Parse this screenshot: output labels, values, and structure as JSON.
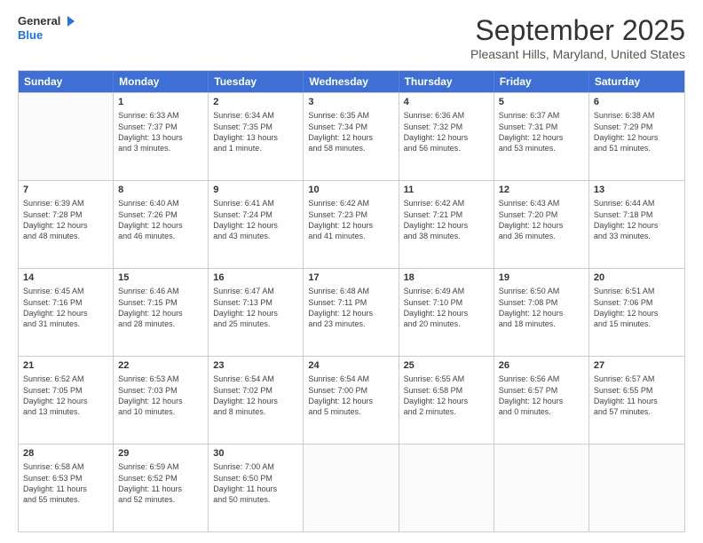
{
  "header": {
    "logo_line1": "General",
    "logo_line2": "Blue",
    "month": "September 2025",
    "location": "Pleasant Hills, Maryland, United States"
  },
  "days": [
    "Sunday",
    "Monday",
    "Tuesday",
    "Wednesday",
    "Thursday",
    "Friday",
    "Saturday"
  ],
  "rows": [
    [
      {
        "day": "",
        "sunrise": "",
        "sunset": "",
        "daylight": ""
      },
      {
        "day": "1",
        "sunrise": "Sunrise: 6:33 AM",
        "sunset": "Sunset: 7:37 PM",
        "daylight": "Daylight: 13 hours",
        "daylight2": "and 3 minutes."
      },
      {
        "day": "2",
        "sunrise": "Sunrise: 6:34 AM",
        "sunset": "Sunset: 7:35 PM",
        "daylight": "Daylight: 13 hours",
        "daylight2": "and 1 minute."
      },
      {
        "day": "3",
        "sunrise": "Sunrise: 6:35 AM",
        "sunset": "Sunset: 7:34 PM",
        "daylight": "Daylight: 12 hours",
        "daylight2": "and 58 minutes."
      },
      {
        "day": "4",
        "sunrise": "Sunrise: 6:36 AM",
        "sunset": "Sunset: 7:32 PM",
        "daylight": "Daylight: 12 hours",
        "daylight2": "and 56 minutes."
      },
      {
        "day": "5",
        "sunrise": "Sunrise: 6:37 AM",
        "sunset": "Sunset: 7:31 PM",
        "daylight": "Daylight: 12 hours",
        "daylight2": "and 53 minutes."
      },
      {
        "day": "6",
        "sunrise": "Sunrise: 6:38 AM",
        "sunset": "Sunset: 7:29 PM",
        "daylight": "Daylight: 12 hours",
        "daylight2": "and 51 minutes."
      }
    ],
    [
      {
        "day": "7",
        "sunrise": "Sunrise: 6:39 AM",
        "sunset": "Sunset: 7:28 PM",
        "daylight": "Daylight: 12 hours",
        "daylight2": "and 48 minutes."
      },
      {
        "day": "8",
        "sunrise": "Sunrise: 6:40 AM",
        "sunset": "Sunset: 7:26 PM",
        "daylight": "Daylight: 12 hours",
        "daylight2": "and 46 minutes."
      },
      {
        "day": "9",
        "sunrise": "Sunrise: 6:41 AM",
        "sunset": "Sunset: 7:24 PM",
        "daylight": "Daylight: 12 hours",
        "daylight2": "and 43 minutes."
      },
      {
        "day": "10",
        "sunrise": "Sunrise: 6:42 AM",
        "sunset": "Sunset: 7:23 PM",
        "daylight": "Daylight: 12 hours",
        "daylight2": "and 41 minutes."
      },
      {
        "day": "11",
        "sunrise": "Sunrise: 6:42 AM",
        "sunset": "Sunset: 7:21 PM",
        "daylight": "Daylight: 12 hours",
        "daylight2": "and 38 minutes."
      },
      {
        "day": "12",
        "sunrise": "Sunrise: 6:43 AM",
        "sunset": "Sunset: 7:20 PM",
        "daylight": "Daylight: 12 hours",
        "daylight2": "and 36 minutes."
      },
      {
        "day": "13",
        "sunrise": "Sunrise: 6:44 AM",
        "sunset": "Sunset: 7:18 PM",
        "daylight": "Daylight: 12 hours",
        "daylight2": "and 33 minutes."
      }
    ],
    [
      {
        "day": "14",
        "sunrise": "Sunrise: 6:45 AM",
        "sunset": "Sunset: 7:16 PM",
        "daylight": "Daylight: 12 hours",
        "daylight2": "and 31 minutes."
      },
      {
        "day": "15",
        "sunrise": "Sunrise: 6:46 AM",
        "sunset": "Sunset: 7:15 PM",
        "daylight": "Daylight: 12 hours",
        "daylight2": "and 28 minutes."
      },
      {
        "day": "16",
        "sunrise": "Sunrise: 6:47 AM",
        "sunset": "Sunset: 7:13 PM",
        "daylight": "Daylight: 12 hours",
        "daylight2": "and 25 minutes."
      },
      {
        "day": "17",
        "sunrise": "Sunrise: 6:48 AM",
        "sunset": "Sunset: 7:11 PM",
        "daylight": "Daylight: 12 hours",
        "daylight2": "and 23 minutes."
      },
      {
        "day": "18",
        "sunrise": "Sunrise: 6:49 AM",
        "sunset": "Sunset: 7:10 PM",
        "daylight": "Daylight: 12 hours",
        "daylight2": "and 20 minutes."
      },
      {
        "day": "19",
        "sunrise": "Sunrise: 6:50 AM",
        "sunset": "Sunset: 7:08 PM",
        "daylight": "Daylight: 12 hours",
        "daylight2": "and 18 minutes."
      },
      {
        "day": "20",
        "sunrise": "Sunrise: 6:51 AM",
        "sunset": "Sunset: 7:06 PM",
        "daylight": "Daylight: 12 hours",
        "daylight2": "and 15 minutes."
      }
    ],
    [
      {
        "day": "21",
        "sunrise": "Sunrise: 6:52 AM",
        "sunset": "Sunset: 7:05 PM",
        "daylight": "Daylight: 12 hours",
        "daylight2": "and 13 minutes."
      },
      {
        "day": "22",
        "sunrise": "Sunrise: 6:53 AM",
        "sunset": "Sunset: 7:03 PM",
        "daylight": "Daylight: 12 hours",
        "daylight2": "and 10 minutes."
      },
      {
        "day": "23",
        "sunrise": "Sunrise: 6:54 AM",
        "sunset": "Sunset: 7:02 PM",
        "daylight": "Daylight: 12 hours",
        "daylight2": "and 8 minutes."
      },
      {
        "day": "24",
        "sunrise": "Sunrise: 6:54 AM",
        "sunset": "Sunset: 7:00 PM",
        "daylight": "Daylight: 12 hours",
        "daylight2": "and 5 minutes."
      },
      {
        "day": "25",
        "sunrise": "Sunrise: 6:55 AM",
        "sunset": "Sunset: 6:58 PM",
        "daylight": "Daylight: 12 hours",
        "daylight2": "and 2 minutes."
      },
      {
        "day": "26",
        "sunrise": "Sunrise: 6:56 AM",
        "sunset": "Sunset: 6:57 PM",
        "daylight": "Daylight: 12 hours",
        "daylight2": "and 0 minutes."
      },
      {
        "day": "27",
        "sunrise": "Sunrise: 6:57 AM",
        "sunset": "Sunset: 6:55 PM",
        "daylight": "Daylight: 11 hours",
        "daylight2": "and 57 minutes."
      }
    ],
    [
      {
        "day": "28",
        "sunrise": "Sunrise: 6:58 AM",
        "sunset": "Sunset: 6:53 PM",
        "daylight": "Daylight: 11 hours",
        "daylight2": "and 55 minutes."
      },
      {
        "day": "29",
        "sunrise": "Sunrise: 6:59 AM",
        "sunset": "Sunset: 6:52 PM",
        "daylight": "Daylight: 11 hours",
        "daylight2": "and 52 minutes."
      },
      {
        "day": "30",
        "sunrise": "Sunrise: 7:00 AM",
        "sunset": "Sunset: 6:50 PM",
        "daylight": "Daylight: 11 hours",
        "daylight2": "and 50 minutes."
      },
      {
        "day": "",
        "sunrise": "",
        "sunset": "",
        "daylight": ""
      },
      {
        "day": "",
        "sunrise": "",
        "sunset": "",
        "daylight": ""
      },
      {
        "day": "",
        "sunrise": "",
        "sunset": "",
        "daylight": ""
      },
      {
        "day": "",
        "sunrise": "",
        "sunset": "",
        "daylight": ""
      }
    ]
  ]
}
